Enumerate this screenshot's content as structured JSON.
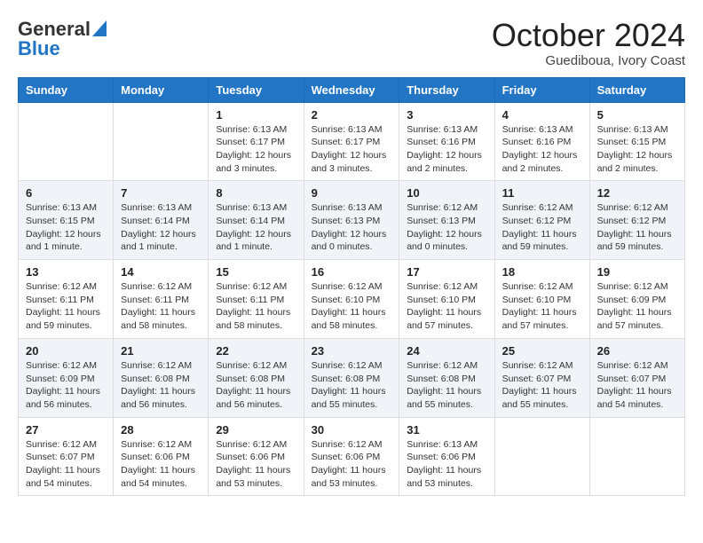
{
  "header": {
    "logo_line1": "General",
    "logo_line2": "Blue",
    "month": "October 2024",
    "location": "Guediboua, Ivory Coast"
  },
  "weekdays": [
    "Sunday",
    "Monday",
    "Tuesday",
    "Wednesday",
    "Thursday",
    "Friday",
    "Saturday"
  ],
  "weeks": [
    [
      {
        "day": "",
        "content": ""
      },
      {
        "day": "",
        "content": ""
      },
      {
        "day": "1",
        "content": "Sunrise: 6:13 AM\nSunset: 6:17 PM\nDaylight: 12 hours and 3 minutes."
      },
      {
        "day": "2",
        "content": "Sunrise: 6:13 AM\nSunset: 6:17 PM\nDaylight: 12 hours and 3 minutes."
      },
      {
        "day": "3",
        "content": "Sunrise: 6:13 AM\nSunset: 6:16 PM\nDaylight: 12 hours and 2 minutes."
      },
      {
        "day": "4",
        "content": "Sunrise: 6:13 AM\nSunset: 6:16 PM\nDaylight: 12 hours and 2 minutes."
      },
      {
        "day": "5",
        "content": "Sunrise: 6:13 AM\nSunset: 6:15 PM\nDaylight: 12 hours and 2 minutes."
      }
    ],
    [
      {
        "day": "6",
        "content": "Sunrise: 6:13 AM\nSunset: 6:15 PM\nDaylight: 12 hours and 1 minute."
      },
      {
        "day": "7",
        "content": "Sunrise: 6:13 AM\nSunset: 6:14 PM\nDaylight: 12 hours and 1 minute."
      },
      {
        "day": "8",
        "content": "Sunrise: 6:13 AM\nSunset: 6:14 PM\nDaylight: 12 hours and 1 minute."
      },
      {
        "day": "9",
        "content": "Sunrise: 6:13 AM\nSunset: 6:13 PM\nDaylight: 12 hours and 0 minutes."
      },
      {
        "day": "10",
        "content": "Sunrise: 6:12 AM\nSunset: 6:13 PM\nDaylight: 12 hours and 0 minutes."
      },
      {
        "day": "11",
        "content": "Sunrise: 6:12 AM\nSunset: 6:12 PM\nDaylight: 11 hours and 59 minutes."
      },
      {
        "day": "12",
        "content": "Sunrise: 6:12 AM\nSunset: 6:12 PM\nDaylight: 11 hours and 59 minutes."
      }
    ],
    [
      {
        "day": "13",
        "content": "Sunrise: 6:12 AM\nSunset: 6:11 PM\nDaylight: 11 hours and 59 minutes."
      },
      {
        "day": "14",
        "content": "Sunrise: 6:12 AM\nSunset: 6:11 PM\nDaylight: 11 hours and 58 minutes."
      },
      {
        "day": "15",
        "content": "Sunrise: 6:12 AM\nSunset: 6:11 PM\nDaylight: 11 hours and 58 minutes."
      },
      {
        "day": "16",
        "content": "Sunrise: 6:12 AM\nSunset: 6:10 PM\nDaylight: 11 hours and 58 minutes."
      },
      {
        "day": "17",
        "content": "Sunrise: 6:12 AM\nSunset: 6:10 PM\nDaylight: 11 hours and 57 minutes."
      },
      {
        "day": "18",
        "content": "Sunrise: 6:12 AM\nSunset: 6:10 PM\nDaylight: 11 hours and 57 minutes."
      },
      {
        "day": "19",
        "content": "Sunrise: 6:12 AM\nSunset: 6:09 PM\nDaylight: 11 hours and 57 minutes."
      }
    ],
    [
      {
        "day": "20",
        "content": "Sunrise: 6:12 AM\nSunset: 6:09 PM\nDaylight: 11 hours and 56 minutes."
      },
      {
        "day": "21",
        "content": "Sunrise: 6:12 AM\nSunset: 6:08 PM\nDaylight: 11 hours and 56 minutes."
      },
      {
        "day": "22",
        "content": "Sunrise: 6:12 AM\nSunset: 6:08 PM\nDaylight: 11 hours and 56 minutes."
      },
      {
        "day": "23",
        "content": "Sunrise: 6:12 AM\nSunset: 6:08 PM\nDaylight: 11 hours and 55 minutes."
      },
      {
        "day": "24",
        "content": "Sunrise: 6:12 AM\nSunset: 6:08 PM\nDaylight: 11 hours and 55 minutes."
      },
      {
        "day": "25",
        "content": "Sunrise: 6:12 AM\nSunset: 6:07 PM\nDaylight: 11 hours and 55 minutes."
      },
      {
        "day": "26",
        "content": "Sunrise: 6:12 AM\nSunset: 6:07 PM\nDaylight: 11 hours and 54 minutes."
      }
    ],
    [
      {
        "day": "27",
        "content": "Sunrise: 6:12 AM\nSunset: 6:07 PM\nDaylight: 11 hours and 54 minutes."
      },
      {
        "day": "28",
        "content": "Sunrise: 6:12 AM\nSunset: 6:06 PM\nDaylight: 11 hours and 54 minutes."
      },
      {
        "day": "29",
        "content": "Sunrise: 6:12 AM\nSunset: 6:06 PM\nDaylight: 11 hours and 53 minutes."
      },
      {
        "day": "30",
        "content": "Sunrise: 6:12 AM\nSunset: 6:06 PM\nDaylight: 11 hours and 53 minutes."
      },
      {
        "day": "31",
        "content": "Sunrise: 6:13 AM\nSunset: 6:06 PM\nDaylight: 11 hours and 53 minutes."
      },
      {
        "day": "",
        "content": ""
      },
      {
        "day": "",
        "content": ""
      }
    ]
  ]
}
